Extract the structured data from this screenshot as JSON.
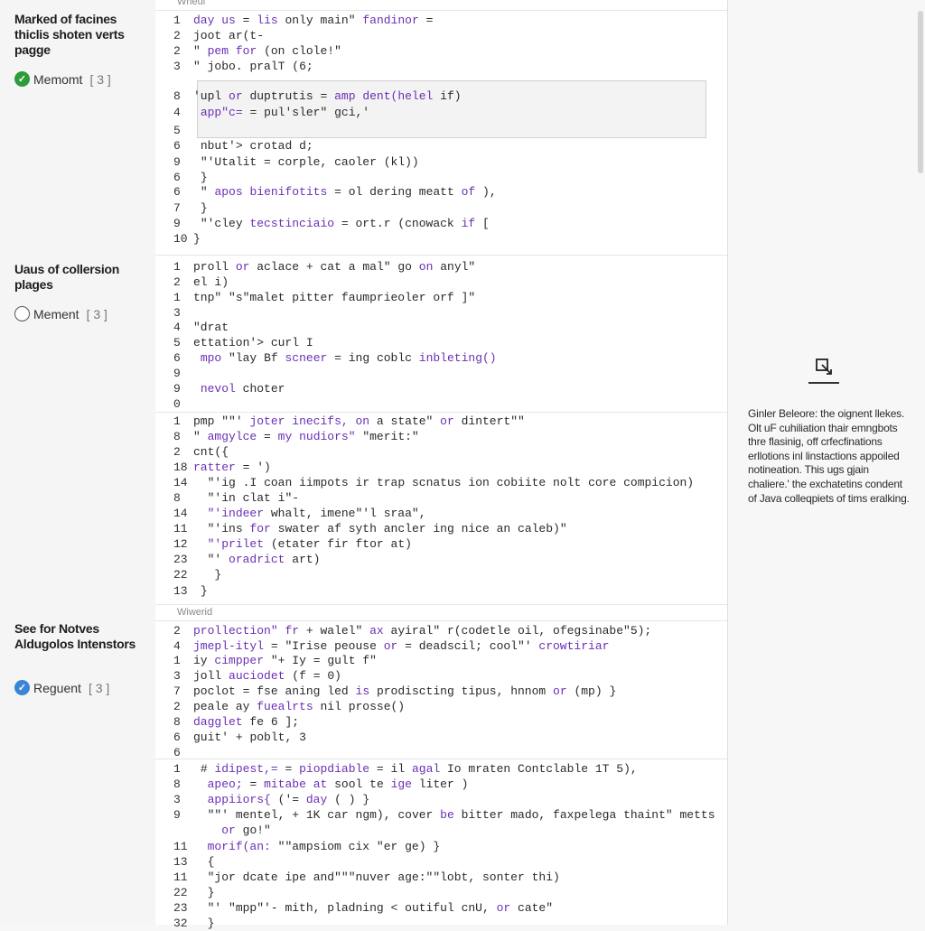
{
  "sidebar": {
    "sections": [
      {
        "title": "Marked of facines thiclis shoten verts pagge",
        "status_label": "Memomt",
        "count": "[ 3 ]",
        "icon": "check-green"
      },
      {
        "title": "Uaus of collersion plages",
        "status_label": "Mement",
        "count": "[ 3 ]",
        "icon": "empty-circle"
      },
      {
        "title": "See for Notves Aldugolos Intenstors",
        "status_label": "Reguent",
        "count": "[ 3 ]",
        "icon": "check-blue"
      }
    ]
  },
  "code": {
    "block_labels": [
      "Wheui",
      "Wiwerid"
    ],
    "lines": [
      {
        "n": "1",
        "t": "day us = lis only main\" fandinor ="
      },
      {
        "n": "2",
        "t": "joot ar(t-"
      },
      {
        "n": "2",
        "t": "\" pem for (on clole!\""
      },
      {
        "n": "3",
        "t": "\" jobo. pralT (6;"
      },
      {
        "n": "8",
        "t": "'upl or duptrutis = amp dent(helel if)"
      },
      {
        "n": "4",
        "t": " app\"c= = pul'sler\" gci,'"
      },
      {
        "n": "5",
        "t": ""
      },
      {
        "n": "6",
        "t": " nbut'> crotad d;"
      },
      {
        "n": "9",
        "t": " \"'Utalit = corple, caoler (kl))"
      },
      {
        "n": "6",
        "t": " }"
      },
      {
        "n": "6",
        "t": " \" apos bienifotits = ol dering meatt of ),"
      },
      {
        "n": "7",
        "t": " }"
      },
      {
        "n": "9",
        "t": " \"'cley tecstinciaio = ort.r (cnowack if ["
      },
      {
        "n": "10",
        "t": "}"
      },
      {
        "n": "1",
        "t": "proll or aclace + cat a mal\" go on anyl\""
      },
      {
        "n": "2",
        "t": "el i)"
      },
      {
        "n": "1",
        "t": "tnp\" \"s\"malet pitter faumprieoler orf ]\""
      },
      {
        "n": "3",
        "t": ""
      },
      {
        "n": "4",
        "t": "\"drat"
      },
      {
        "n": "5",
        "t": "ettation'> curl I"
      },
      {
        "n": "6",
        "t": " mpo \"lay Bf scneer = ing coblc inbleting()"
      },
      {
        "n": "9",
        "t": ""
      },
      {
        "n": "9",
        "t": " nevol choter"
      },
      {
        "n": "0",
        "t": ""
      },
      {
        "n": "1",
        "t": "pmp \"\"' joter inecifs, on a state\" or dintert\"\""
      },
      {
        "n": "8",
        "t": "\" amgylce = my nudiors\" \"merit:\""
      },
      {
        "n": "2",
        "t": "cnt({"
      },
      {
        "n": "18",
        "t": "ratter = ')"
      },
      {
        "n": "14",
        "t": "  \"'ig .I coan iimpots ir trap scnatus ion cobiite nolt core compicion)"
      },
      {
        "n": "8",
        "t": "  \"'in clat i\"-"
      },
      {
        "n": "14",
        "t": "  \"'indeer whalt, imene\"'l sraa\","
      },
      {
        "n": "11",
        "t": "  \"'ins for swater af syth ancler ing nice an caleb)\""
      },
      {
        "n": "12",
        "t": "  \"'prilet (etater fir ftor at)"
      },
      {
        "n": "23",
        "t": "  \"' oradrict art)"
      },
      {
        "n": "22",
        "t": "   }"
      },
      {
        "n": "13",
        "t": " }"
      },
      {
        "n": "2",
        "t": "prollection\" fr + walel\" ax ayiral\" r(codetle oil, ofegsinabe\"5);"
      },
      {
        "n": "4",
        "t": "jmepl-ityl = \"Irise peouse or = deadscil; cool\"' crowtiriar"
      },
      {
        "n": "1",
        "t": "iy cimpper \"+ Iy = gult f\""
      },
      {
        "n": "3",
        "t": "joll auciodet (f = 0)"
      },
      {
        "n": "7",
        "t": "poclot = fse aning led is prodiscting tipus, hnnom or (mp) }"
      },
      {
        "n": "2",
        "t": "peale ay fuealrts nil prosse()"
      },
      {
        "n": "8",
        "t": "dagglet fe 6 ];"
      },
      {
        "n": "6",
        "t": "guit' + poblt, 3"
      },
      {
        "n": "6",
        "t": ""
      },
      {
        "n": "1",
        "t": " # idipest,= = piopdiable = il agal Io mraten Contclable 1T 5),"
      },
      {
        "n": "8",
        "t": "  apeo; = mitabe at sool te ige liter )"
      },
      {
        "n": "3",
        "t": "  appiiors{ ('= day ( ) }"
      },
      {
        "n": "9",
        "t": "  \"\"' mentel, + 1K car ngm), cover be bitter mado, faxpelega thaint\" metts"
      },
      {
        "n": "",
        "t": "    or go!\""
      },
      {
        "n": "11",
        "t": "  morif(an: \"\"ampsiom cix \"er ge) }"
      },
      {
        "n": "13",
        "t": "  {"
      },
      {
        "n": "11",
        "t": "  \"jor dcate ipe and\"\"\"nuver age:\"\"lobt, sonter thi)"
      },
      {
        "n": "22",
        "t": "  }"
      },
      {
        "n": "23",
        "t": "  \"' \"mpp\"'- mith, pladning < outiful cnU, or cate\""
      },
      {
        "n": "32",
        "t": "  }"
      }
    ]
  },
  "right_panel": {
    "note": "Ginler Beleore: the oignent llekes. Olt uF cuhiliation thair emngbots thre flasinig, off crfecfinations erllotions inl linstactions appoiled notineation. This ugs gjain chaliere.' the exchatetins condent of Java colleqpiets of tims eralking."
  },
  "colors": {
    "keyword": "#6a2fb5",
    "check_green": "#2e9c3a",
    "check_blue": "#3a86d6"
  }
}
